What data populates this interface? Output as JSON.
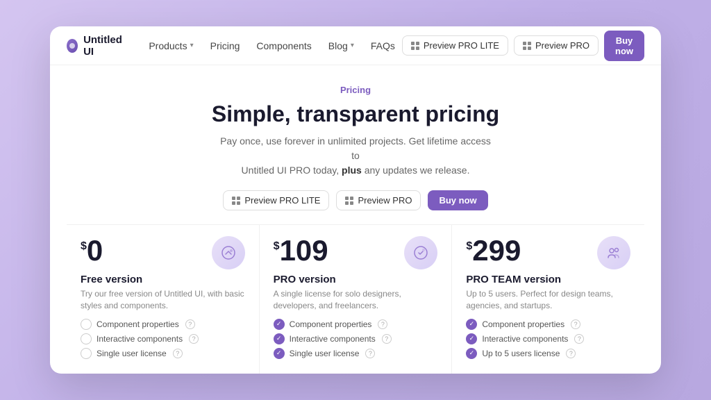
{
  "background": "#c4b5e8",
  "navbar": {
    "brand": "Untitled UI",
    "links": [
      {
        "label": "Products",
        "hasDropdown": true
      },
      {
        "label": "Pricing",
        "hasDropdown": false
      },
      {
        "label": "Components",
        "hasDropdown": false
      },
      {
        "label": "Blog",
        "hasDropdown": true
      },
      {
        "label": "FAQs",
        "hasDropdown": false
      }
    ],
    "actions": {
      "preview_lite": "Preview PRO LITE",
      "preview_pro": "Preview PRO",
      "buy_now": "Buy now"
    }
  },
  "hero": {
    "label": "Pricing",
    "title": "Simple, transparent pricing",
    "subtitle_1": "Pay once, use forever in unlimited projects. Get lifetime access to",
    "subtitle_2": "Untitled UI PRO today,",
    "subtitle_bold": "plus",
    "subtitle_3": "any updates we release.",
    "btn_preview_lite": "Preview PRO LITE",
    "btn_preview_pro": "Preview PRO",
    "btn_buy": "Buy now"
  },
  "pricing": {
    "plans": [
      {
        "currency": "$",
        "price": "0",
        "name": "Free version",
        "description": "Try our free version of Untitled UI, with basic styles and components.",
        "features": [
          {
            "label": "Component properties",
            "checked": false
          },
          {
            "label": "Interactive components",
            "checked": false
          },
          {
            "label": "Single user license",
            "checked": false
          }
        ]
      },
      {
        "currency": "$",
        "price": "109",
        "name": "PRO version",
        "description": "A single license for solo designers, developers, and freelancers.",
        "features": [
          {
            "label": "Component properties",
            "checked": true
          },
          {
            "label": "Interactive components",
            "checked": true
          },
          {
            "label": "Single user license",
            "checked": true
          }
        ]
      },
      {
        "currency": "$",
        "price": "299",
        "name": "PRO TEAM version",
        "description": "Up to 5 users. Perfect for design teams, agencies, and startups.",
        "features": [
          {
            "label": "Component properties",
            "checked": true
          },
          {
            "label": "Interactive components",
            "checked": true
          },
          {
            "label": "Up to 5 users license",
            "checked": true
          }
        ]
      }
    ]
  }
}
